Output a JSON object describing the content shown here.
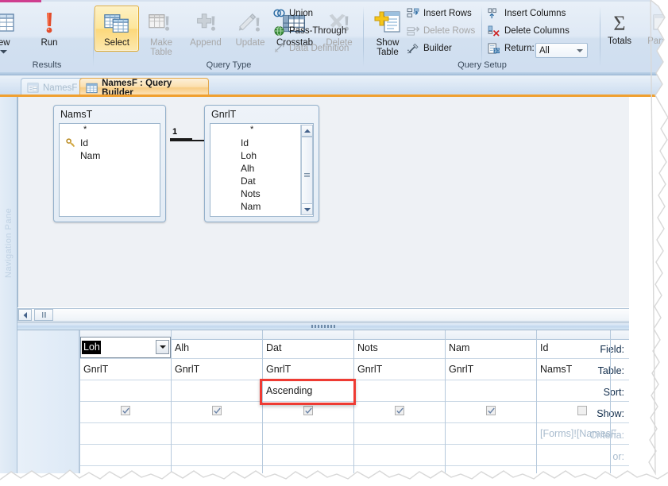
{
  "app": {
    "title": "NamesF : Query Builder"
  },
  "ribbon": {
    "groups": [
      {
        "name": "results",
        "label": "Results"
      },
      {
        "name": "query_type",
        "label": "Query Type"
      },
      {
        "name": "query_setup",
        "label": "Query Setup"
      },
      {
        "name": "show_hide",
        "label": ""
      }
    ],
    "results": {
      "view_label": "iew",
      "view_icon": "datasheet-view-icon",
      "run_label": "Run",
      "run_icon": "run-exclamation-icon"
    },
    "query_type": {
      "select_label": "Select",
      "make_table_label": "Make\nTable",
      "make_table_line1": "Make",
      "make_table_line2": "Table",
      "append_label": "Append",
      "update_label": "Update",
      "crosstab_label": "Crosstab",
      "delete_label": "Delete",
      "union_label": "Union",
      "pass_through_label": "Pass-Through",
      "data_definition_label": "Data Definition"
    },
    "query_setup": {
      "show_table_line1": "Show",
      "show_table_line2": "Table",
      "insert_rows_label": "Insert Rows",
      "delete_rows_label": "Delete Rows",
      "builder_label": "Builder",
      "insert_columns_label": "Insert Columns",
      "delete_columns_label": "Delete Columns",
      "return_label": "Return:",
      "return_value": "All"
    },
    "show_hide": {
      "totals_label": "Totals",
      "totals_icon": "sigma-icon",
      "parameters_label": "Param"
    }
  },
  "tabs": [
    {
      "label": "NamesF",
      "active": false,
      "icon": "form-icon"
    },
    {
      "label": "NamesF : Query Builder",
      "active": true,
      "icon": "query-icon"
    }
  ],
  "navigation_pane": {
    "label": "Navigation Pane"
  },
  "diagram": {
    "tables": [
      {
        "name": "NamsT",
        "fields": [
          "*",
          "Id",
          "Nam"
        ],
        "key_field": "Id",
        "has_scrollbar": false
      },
      {
        "name": "GnrlT",
        "fields": [
          "*",
          "Id",
          "Loh",
          "Alh",
          "Dat",
          "Nots",
          "Nam"
        ],
        "key_field": "",
        "has_scrollbar": true
      }
    ],
    "join": {
      "left_label": "1",
      "right_label": "∞"
    }
  },
  "query_grid": {
    "row_labels": [
      "Field:",
      "Table:",
      "Sort:",
      "Show:",
      "Criteria:",
      "or:"
    ],
    "columns": [
      {
        "field": "Loh",
        "table": "GnrlT",
        "sort": "",
        "show": true,
        "criteria": ""
      },
      {
        "field": "Alh",
        "table": "GnrlT",
        "sort": "",
        "show": true,
        "criteria": ""
      },
      {
        "field": "Dat",
        "table": "GnrlT",
        "sort": "Ascending",
        "show": true,
        "criteria": ""
      },
      {
        "field": "Nots",
        "table": "GnrlT",
        "sort": "",
        "show": true,
        "criteria": ""
      },
      {
        "field": "Nam",
        "table": "GnrlT",
        "sort": "",
        "show": true,
        "criteria": ""
      },
      {
        "field": "Id",
        "table": "NamsT",
        "sort": "",
        "show": false,
        "criteria": "[Forms]![NamesF]"
      }
    ],
    "active_cell": {
      "column": 0,
      "row": "Field",
      "selected_text": "Loh"
    },
    "highlight": {
      "column": 2,
      "row": "Sort",
      "color": "#ee3b33"
    }
  }
}
